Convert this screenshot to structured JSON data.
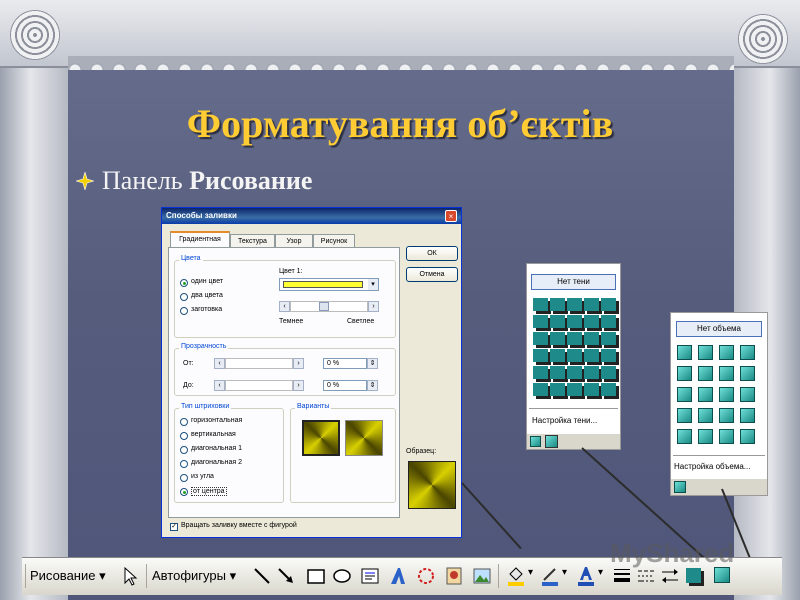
{
  "slide": {
    "title": "Форматування об’єктів",
    "bullet_prefix": "Панель ",
    "bullet_bold": "Рисование"
  },
  "dialog": {
    "title": "Способы заливки",
    "close_glyph": "×",
    "tabs": [
      "Градиентная",
      "Текстура",
      "Узор",
      "Рисунок"
    ],
    "ok_label": "ОК",
    "cancel_label": "Отмена",
    "colors_group": "Цвета",
    "color_radios": [
      "один цвет",
      "два цвета",
      "заготовка"
    ],
    "color1_label": "Цвет 1:",
    "color1_value": "#ffff33",
    "darker_label": "Темнее",
    "lighter_label": "Светлее",
    "transparency_group": "Прозрачность",
    "from_label": "От:",
    "to_label": "До:",
    "from_value": "0 %",
    "to_value": "0 %",
    "hatch_group": "Тип штриховки",
    "hatch_radios": [
      "горизонтальная",
      "вертикальная",
      "диагональная 1",
      "диагональная 2",
      "из угла",
      "от центра"
    ],
    "variants_group": "Варианты",
    "sample_label": "Образец:",
    "rotate_checkbox": "Вращать заливку вместе с фигурой"
  },
  "shadow_palette": {
    "none_label": "Нет тени",
    "settings_label": "Настройка тени..."
  },
  "volume_palette": {
    "none_label": "Нет объема",
    "settings_label": "Настройка объема..."
  },
  "toolbar": {
    "drawing_label": "Рисование",
    "autoshapes_label": "Автофигуры",
    "dropdown_glyph": "▾"
  },
  "watermark": "MyShared"
}
